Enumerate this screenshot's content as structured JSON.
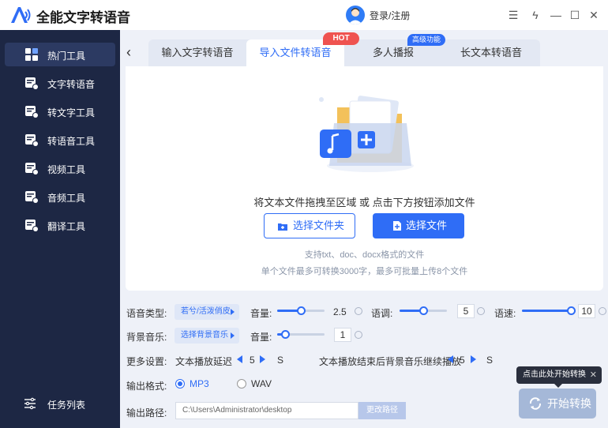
{
  "app": {
    "title": "全能文字转语音",
    "login": "登录/注册"
  },
  "window": {
    "menu": "☰",
    "skin": "ϟ",
    "minimize": "—",
    "maximize": "☐",
    "close": "✕"
  },
  "sidebar": {
    "items": [
      {
        "label": "热门工具",
        "icon": "grid-icon",
        "active": true
      },
      {
        "label": "文字转语音",
        "icon": "tool-icon"
      },
      {
        "label": "转文字工具",
        "icon": "tool-icon"
      },
      {
        "label": "转语音工具",
        "icon": "tool-icon"
      },
      {
        "label": "视频工具",
        "icon": "tool-icon"
      },
      {
        "label": "音频工具",
        "icon": "tool-icon"
      },
      {
        "label": "翻译工具",
        "icon": "tool-icon"
      }
    ],
    "task_list": "任务列表"
  },
  "tabs": {
    "items": [
      "输入文字转语音",
      "导入文件转语音",
      "多人播报",
      "长文本转语音"
    ],
    "active": 1,
    "hot_badge": "HOT",
    "adv_badge": "高级功能"
  },
  "upload": {
    "drop_text": "将文本文件拖拽至区域 或 点击下方按钮添加文件",
    "choose_folder": "选择文件夹",
    "choose_file": "选择文件",
    "support": "支持txt、doc、docx格式的文件",
    "limit": "单个文件最多可转换3000字，最多可批量上传8个文件"
  },
  "settings": {
    "voice_type_label": "语音类型:",
    "voice_type_value": "若兮/活泼俏皮",
    "volume_label": "音量:",
    "volume_value": "2.5",
    "pitch_label": "语调:",
    "pitch_value": "5",
    "speed_label": "语速:",
    "speed_value": "10",
    "bgm_label": "背景音乐:",
    "bgm_value": "选择背景音乐",
    "bgm_volume_label": "音量:",
    "bgm_volume_value": "1",
    "more_label": "更多设置:",
    "delay_label": "文本播放延迟",
    "delay_value": "5",
    "delay_unit": "S",
    "bgm_continue_label": "文本播放结束后背景音乐继续播放",
    "bgm_continue_value": "5",
    "bgm_continue_unit": "S",
    "format_label": "输出格式:",
    "format_mp3": "MP3",
    "format_wav": "WAV",
    "format_selected": "MP3",
    "path_label": "输出路径:",
    "path_value": "C:\\Users\\Administrator\\desktop",
    "path_button": "更改路径"
  },
  "levels": {
    "volume": 0.5,
    "pitch": 0.5,
    "speed": 1.0,
    "bgm_volume": 0.1
  },
  "start": {
    "tooltip": "点击此处开始转换",
    "tooltip_close": "✕",
    "button": "开始转换"
  },
  "colors": {
    "accent": "#2f6df6",
    "sidebar_bg": "#1d2744",
    "hot": "#ef5350",
    "disabled_button": "#a5b8d8"
  }
}
